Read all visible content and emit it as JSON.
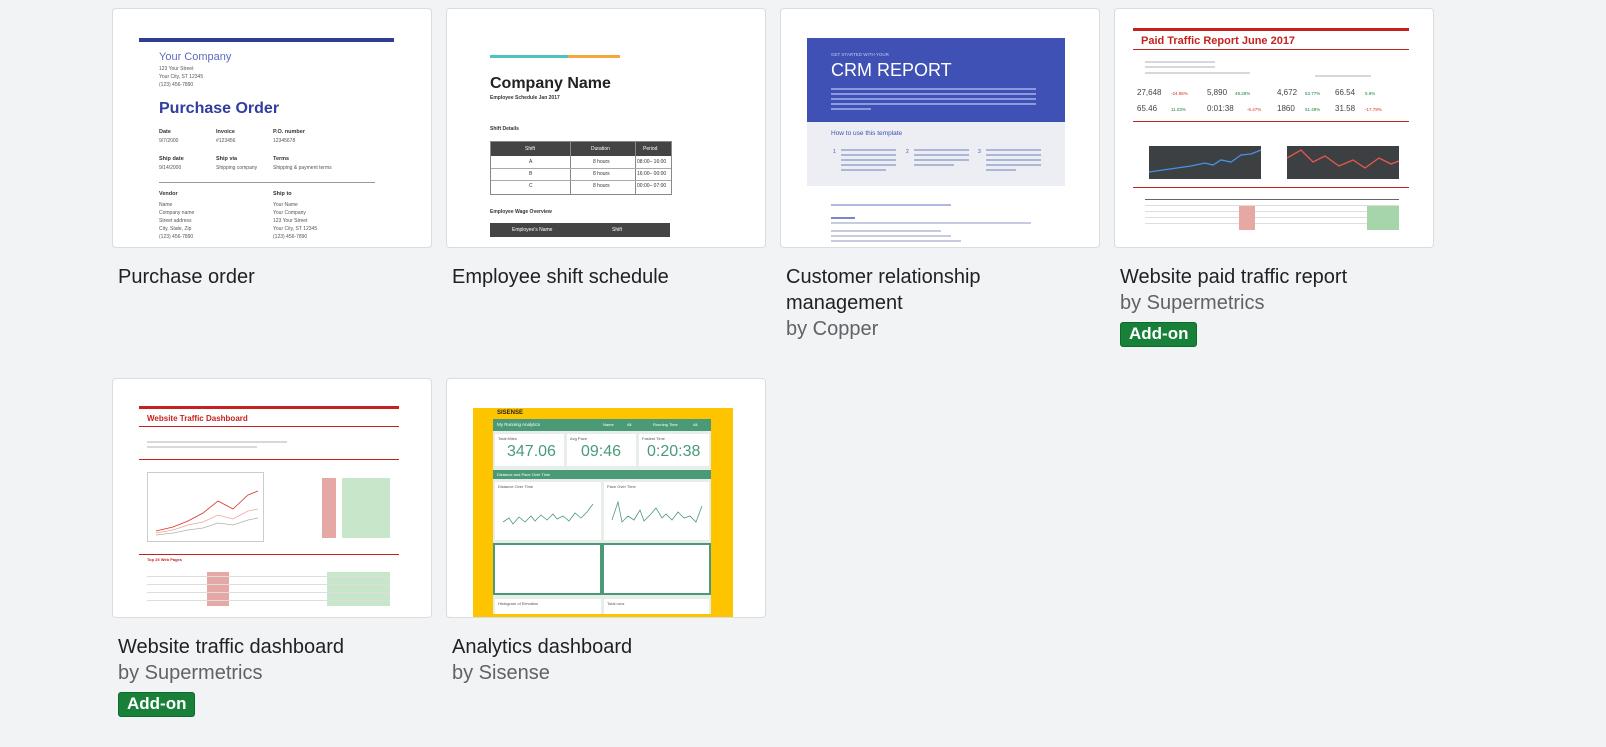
{
  "templates": [
    {
      "title": "Purchase order",
      "author": "",
      "badge": "",
      "preview": {
        "company": "Your Company",
        "address": [
          "123 Your Street",
          "Your City, ST 12345",
          "(123) 456-7890"
        ],
        "heading": "Purchase Order",
        "fields_row1": [
          {
            "label": "Date",
            "value": "9/7/2000"
          },
          {
            "label": "Invoice",
            "value": "#123456"
          },
          {
            "label": "P.O. number",
            "value": "12345678"
          }
        ],
        "fields_row2": [
          {
            "label": "Ship date",
            "value": "9/14/2000"
          },
          {
            "label": "Ship via",
            "value": "Shipping company"
          },
          {
            "label": "Terms",
            "value": "Shipping & payment terms"
          }
        ],
        "vendor_label": "Vendor",
        "vendor_lines": [
          "Name",
          "Company name",
          "Street address",
          "City, State, Zip",
          "(123) 456-7890"
        ],
        "shipto_label": "Ship to",
        "shipto_lines": [
          "Your Name",
          "Your Company",
          "123 Your Street",
          "Your City, ST 12345",
          "(123) 456-7890"
        ]
      }
    },
    {
      "title": "Employee shift schedule",
      "author": "",
      "badge": "",
      "preview": {
        "company": "Company Name",
        "subtitle": "Employee Schedule Jan 2017",
        "section1": "Shift Details",
        "headers": [
          "Shift",
          "Duration",
          "Period"
        ],
        "rows": [
          [
            "A",
            "8 hours",
            "08:00– 16:00"
          ],
          [
            "B",
            "8 hours",
            "16:00– 00:00"
          ],
          [
            "C",
            "8 hours",
            "00:00– 07:00"
          ]
        ],
        "section2": "Employee Wage Overview",
        "headers2": [
          "Employee's Name",
          "Shift"
        ]
      }
    },
    {
      "title": "Customer relationship management",
      "author": "by Copper",
      "badge": "",
      "preview": {
        "kicker": "GET STARTED WITH YOUR",
        "heading": "CRM REPORT",
        "howto": "How to use this template",
        "steps": [
          "1",
          "2",
          "3"
        ]
      }
    },
    {
      "title": "Website paid traffic report",
      "author": "by Supermetrics",
      "badge": "Add-on",
      "preview": {
        "heading": "Paid Traffic Report June 2017",
        "kpis_row1": [
          {
            "value": "27,648",
            "delta": "-24.86%",
            "color": "#d93025"
          },
          {
            "value": "5,890",
            "delta": "49.28%",
            "color": "#188038"
          },
          {
            "value": "4,672",
            "delta": "53.77%",
            "color": "#188038"
          },
          {
            "value": "66.54",
            "delta": "5.9%",
            "color": "#188038"
          }
        ],
        "kpis_row2": [
          {
            "value": "65.46",
            "delta": "11.03%",
            "color": "#188038"
          },
          {
            "value": "0:01:38",
            "delta": "-6.47%",
            "color": "#d93025"
          },
          {
            "value": "1860",
            "delta": "51.49%",
            "color": "#188038"
          },
          {
            "value": "31.58",
            "delta": "-17.79%",
            "color": "#d93025"
          }
        ]
      }
    },
    {
      "title": "Website traffic dashboard",
      "author": "by Supermetrics",
      "badge": "Add-on",
      "preview": {
        "heading": "Website Traffic Dashboard",
        "section": "Top 25 Web Pages"
      }
    },
    {
      "title": "Analytics dashboard",
      "author": "by Sisense",
      "badge": "",
      "preview": {
        "brand": "SISENSE",
        "header": "My Running Analytics",
        "filter1": "Name",
        "filter1_value": "All",
        "filter2": "Running Time",
        "filter2_value": "All",
        "kpis": [
          {
            "label": "Total Miles",
            "value": "347.06"
          },
          {
            "label": "Avg Pace",
            "value": "09:46"
          },
          {
            "label": "Fastest Time",
            "value": "0:20:38"
          }
        ],
        "section": "Distance and Pace Over Time",
        "chart1": "Distance Over Time",
        "chart2": "Pace Over Time",
        "bottom1": "Histogram of Elevation",
        "bottom2": "Total runs"
      }
    }
  ],
  "colors": {
    "addon": "#188038",
    "crm_blue": "#3f51b5",
    "report_red": "#c5221f",
    "sisense_yellow": "#ffc400",
    "sisense_green": "#4a9a78"
  }
}
